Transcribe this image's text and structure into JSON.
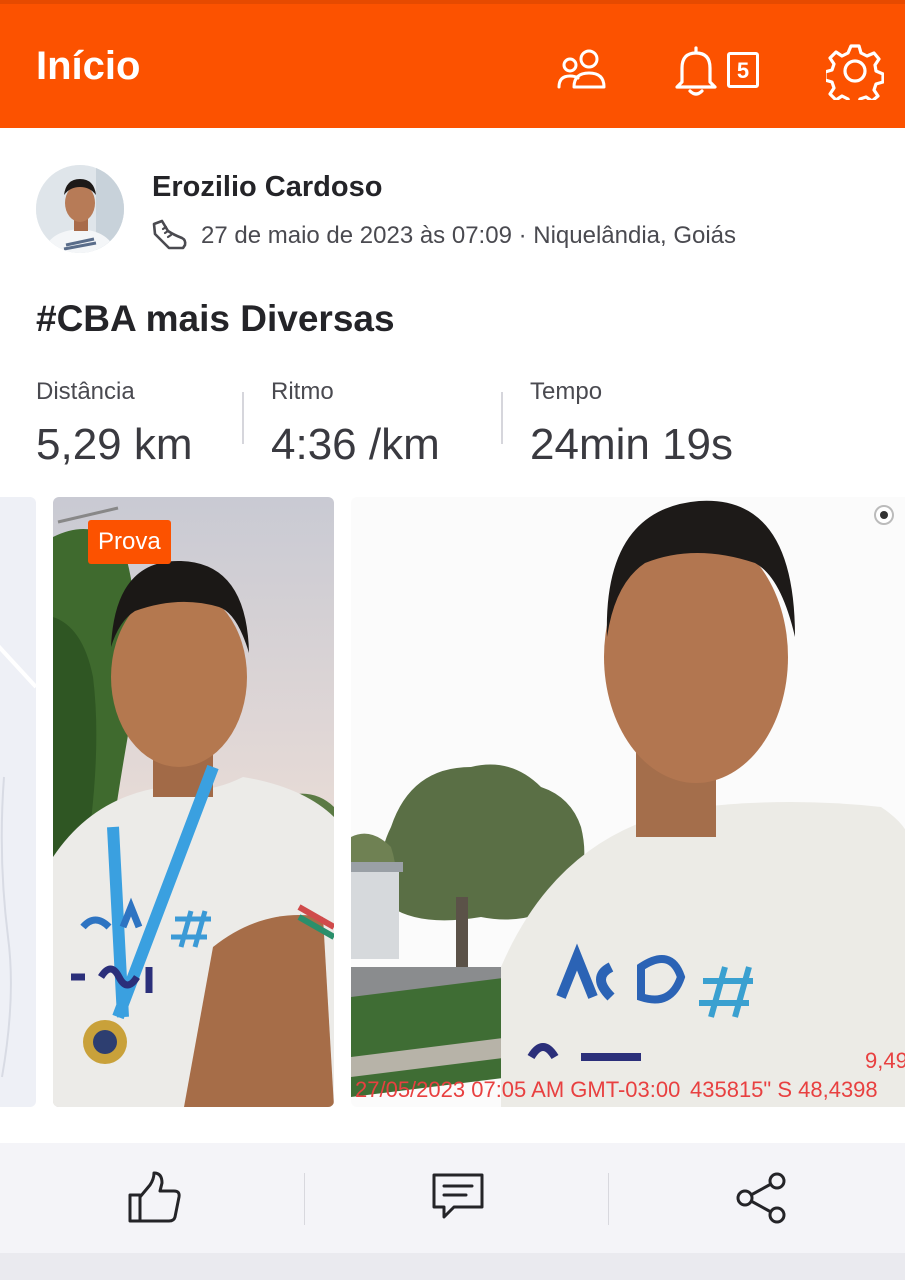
{
  "header": {
    "title": "Início",
    "notifications_count": "5"
  },
  "activity": {
    "athlete_name": "Erozilio Cardoso",
    "date_location": "27 de maio de 2023 às 07:09 · Niquelândia, Goiás",
    "title": "#CBA mais Diversas",
    "stats": [
      {
        "label": "Distância",
        "value": "5,29 km"
      },
      {
        "label": "Ritmo",
        "value": "4:36 /km"
      },
      {
        "label": "Tempo",
        "value": "24min 19s"
      }
    ],
    "race_tag": "Prova",
    "photo_overlay": {
      "timestamp": "27/05/2023 07:05 AM GMT-03:00",
      "coordinates": "9,49",
      "coordinates_line2": "435815\" S 48,4398"
    }
  },
  "colors": {
    "brand": "#fc5200",
    "text_primary": "#242428",
    "text_secondary": "#4a4a50"
  },
  "icons": [
    "people-icon",
    "bell-icon",
    "gear-icon",
    "shoe-icon",
    "like-icon",
    "comment-icon",
    "share-icon"
  ]
}
